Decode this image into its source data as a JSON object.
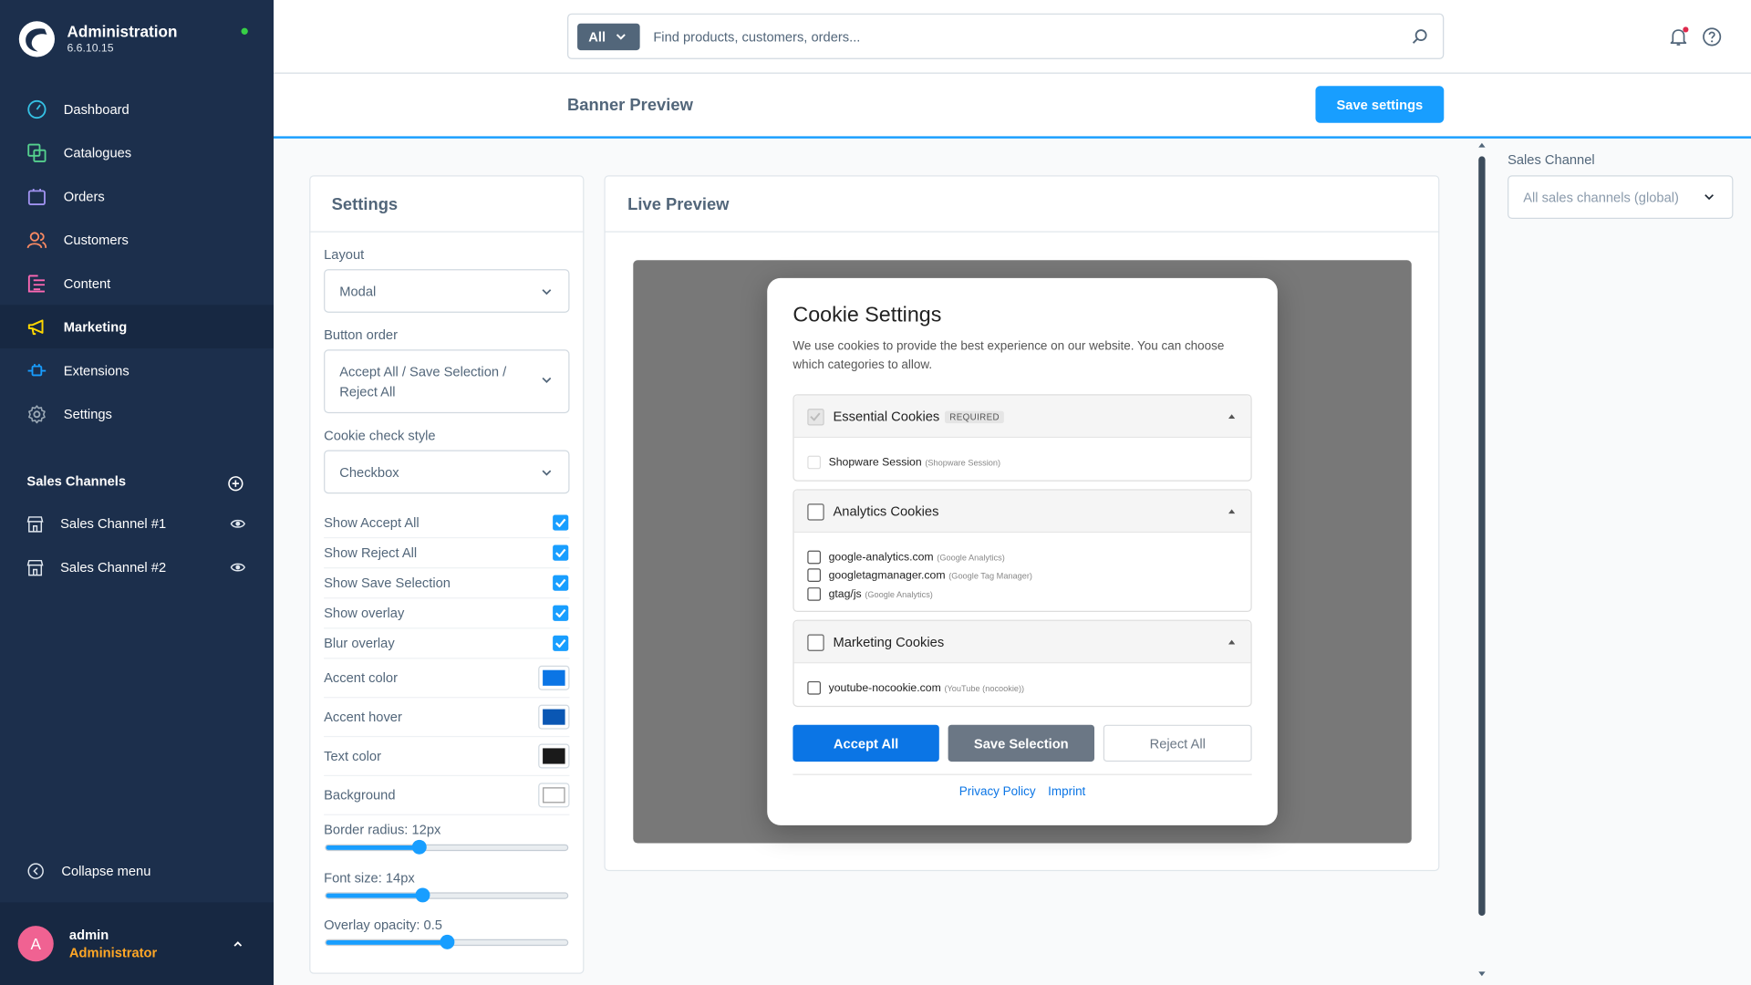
{
  "app": {
    "title": "Administration",
    "version": "6.6.10.15"
  },
  "nav": [
    {
      "label": "Dashboard",
      "icon": "dashboard-icon",
      "color": "#35c1e4"
    },
    {
      "label": "Catalogues",
      "icon": "catalogue-icon",
      "color": "#55d18e"
    },
    {
      "label": "Orders",
      "icon": "orders-icon",
      "color": "#a092f0"
    },
    {
      "label": "Customers",
      "icon": "customers-icon",
      "color": "#f88962"
    },
    {
      "label": "Content",
      "icon": "content-icon",
      "color": "#ff68b4"
    },
    {
      "label": "Marketing",
      "icon": "megaphone-icon",
      "color": "#ffd700"
    },
    {
      "label": "Extensions",
      "icon": "plug-icon",
      "color": "#189eff"
    },
    {
      "label": "Settings",
      "icon": "gear-icon",
      "color": "#9aa8b5"
    }
  ],
  "sales_channels": {
    "title": "Sales Channels",
    "items": [
      "Sales Channel #1",
      "Sales Channel #2"
    ]
  },
  "collapse_label": "Collapse menu",
  "user": {
    "initial": "A",
    "name": "admin",
    "role": "Administrator"
  },
  "search": {
    "filter": "All",
    "placeholder": "Find products, customers, orders..."
  },
  "page": {
    "title": "Banner Preview",
    "save_label": "Save settings"
  },
  "settings": {
    "title": "Settings",
    "layout": {
      "label": "Layout",
      "value": "Modal"
    },
    "button_order": {
      "label": "Button order",
      "value": "Accept All / Save Selection / Reject All"
    },
    "check_style": {
      "label": "Cookie check style",
      "value": "Checkbox"
    },
    "toggles": [
      {
        "label": "Show Accept All",
        "checked": true
      },
      {
        "label": "Show Reject All",
        "checked": true
      },
      {
        "label": "Show Save Selection",
        "checked": true
      },
      {
        "label": "Show overlay",
        "checked": true
      },
      {
        "label": "Blur overlay",
        "checked": true
      }
    ],
    "colors": [
      {
        "label": "Accent color",
        "value": "#0b75e5"
      },
      {
        "label": "Accent hover",
        "value": "#0a57b4"
      },
      {
        "label": "Text color",
        "value": "#1a1a1a"
      },
      {
        "label": "Background",
        "value": "#ffffff"
      }
    ],
    "sliders": [
      {
        "label": "Border radius: 12px",
        "fraction": 0.385
      },
      {
        "label": "Font size: 14px",
        "fraction": 0.4
      },
      {
        "label": "Overlay opacity: 0.5",
        "fraction": 0.5
      }
    ]
  },
  "preview": {
    "title": "Live Preview",
    "modal_title": "Cookie Settings",
    "description": "We use cookies to provide the best experience on our website. You can choose which categories to allow.",
    "categories": [
      {
        "name": "Essential Cookies",
        "badge": "REQUIRED",
        "items": [
          {
            "name": "Shopware Session",
            "provider": "(Shopware Session)"
          }
        ]
      },
      {
        "name": "Analytics Cookies",
        "items": [
          {
            "name": "google-analytics.com",
            "provider": "(Google Analytics)"
          },
          {
            "name": "googletagmanager.com",
            "provider": "(Google Tag Manager)"
          },
          {
            "name": "gtag/js",
            "provider": "(Google Analytics)"
          }
        ]
      },
      {
        "name": "Marketing Cookies",
        "items": [
          {
            "name": "youtube-nocookie.com",
            "provider": "(YouTube (nocookie))"
          }
        ]
      }
    ],
    "buttons": {
      "accept": "Accept All",
      "save": "Save Selection",
      "reject": "Reject All"
    },
    "links": {
      "privacy": "Privacy Policy",
      "imprint": "Imprint"
    }
  },
  "sidebar_right": {
    "label": "Sales Channel",
    "value": "All sales channels (global)"
  },
  "colors": {
    "brand": "#189eff",
    "sidebar": "#1c2f4c",
    "accent": "#0b75e5",
    "save_btn": "#6b7785"
  }
}
